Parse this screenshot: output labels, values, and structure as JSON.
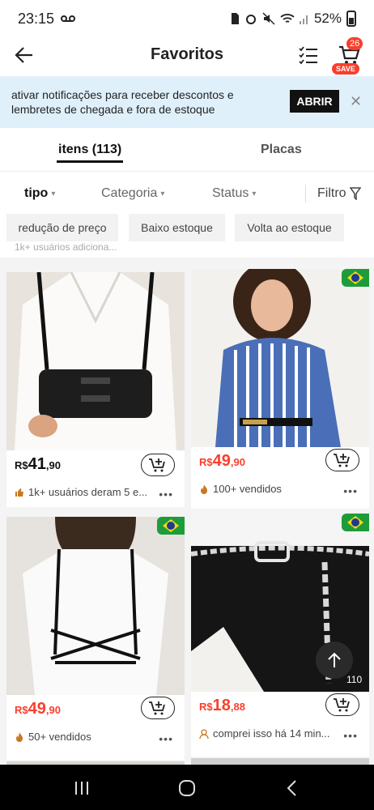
{
  "status_bar": {
    "time": "23:15",
    "battery": "52%"
  },
  "header": {
    "title": "Favoritos",
    "cart_count": "26",
    "save_label": "SAVE"
  },
  "notification": {
    "text": "ativar notificações para receber descontos e lembretes de chegada e fora de estoque",
    "button_label": "ABRIR"
  },
  "tabs": [
    {
      "label": "itens (113)",
      "active": true
    },
    {
      "label": "Placas",
      "active": false
    }
  ],
  "filters": {
    "tipo": "tipo",
    "categoria": "Categoria",
    "status": "Status",
    "filtro": "Filtro"
  },
  "chips": [
    "redução de preço",
    "Baixo estoque",
    "Volta ao estoque"
  ],
  "peek_text": "1k+ usuários adiciona...",
  "products": [
    {
      "price_currency": "R$",
      "price_int": "41",
      "price_dec": ",90",
      "meta": "1k+ usuários deram 5 e...",
      "meta_icon": "thumbs-up-icon",
      "flag": false
    },
    {
      "price_currency": "R$",
      "price_int": "49",
      "price_dec": ",90",
      "meta": "100+ vendidos",
      "meta_icon": "fire-icon",
      "flag": true
    },
    {
      "price_currency": "R$",
      "price_int": "49",
      "price_dec": ",90",
      "meta": "50+ vendidos",
      "meta_icon": "fire-icon",
      "flag": true
    },
    {
      "price_currency": "R$",
      "price_int": "18",
      "price_dec": ",88",
      "meta": "comprei isso há 14 min...",
      "meta_icon": "user-icon",
      "flag": true
    }
  ],
  "back_to_top_count": "110",
  "colors": {
    "accent": "#fa3e2c",
    "notif_bg": "#dff0fb",
    "flag_green": "#1e9c3a"
  }
}
